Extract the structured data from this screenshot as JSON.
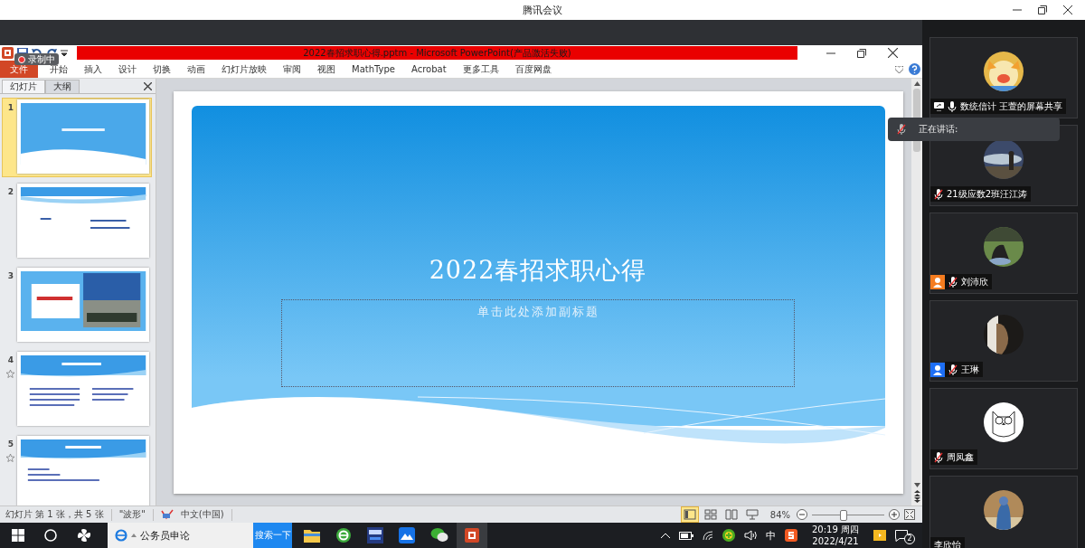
{
  "meeting": {
    "title": "腾讯会议"
  },
  "ppt": {
    "title": "2022春招求职心得.pptm - Microsoft PowerPoint(产品激活失败)",
    "ribbon_tabs": [
      {
        "label": "文件",
        "kind": "file"
      },
      {
        "label": "开始",
        "kind": "tab"
      },
      {
        "label": "插入",
        "kind": "tab"
      },
      {
        "label": "设计",
        "kind": "tab"
      },
      {
        "label": "切换",
        "kind": "tab"
      },
      {
        "label": "动画",
        "kind": "tab"
      },
      {
        "label": "幻灯片放映",
        "kind": "tab"
      },
      {
        "label": "审阅",
        "kind": "tab"
      },
      {
        "label": "视图",
        "kind": "tab"
      },
      {
        "label": "MathType",
        "kind": "tab"
      },
      {
        "label": "Acrobat",
        "kind": "tab"
      },
      {
        "label": "更多工具",
        "kind": "tab"
      },
      {
        "label": "百度网盘",
        "kind": "tab"
      }
    ],
    "panel_tabs": [
      {
        "label": "幻灯片",
        "selected": true
      },
      {
        "label": "大纲",
        "selected": false
      }
    ],
    "slides": [
      {
        "number": "1",
        "selected": true,
        "animated": false,
        "kind": "title"
      },
      {
        "number": "2",
        "selected": false,
        "animated": false,
        "kind": "contents"
      },
      {
        "number": "3",
        "selected": false,
        "animated": false,
        "kind": "photos"
      },
      {
        "number": "4",
        "selected": false,
        "animated": true,
        "kind": "columns"
      },
      {
        "number": "5",
        "selected": false,
        "animated": true,
        "kind": "list"
      }
    ],
    "slide": {
      "title": "2022春招求职心得",
      "subtitle_placeholder": "单击此处添加副标题"
    },
    "status_bar": {
      "position": "幻灯片 第 1 张，共 5 张",
      "theme": "\"波形\"",
      "language": "中文(中国)",
      "zoom": "84%",
      "zoom_slider": {
        "level": 0.42
      }
    },
    "views": [
      {
        "kind": "normal",
        "selected": true
      },
      {
        "kind": "sorter",
        "selected": false
      },
      {
        "kind": "reading",
        "selected": false
      },
      {
        "kind": "show",
        "selected": false
      }
    ]
  },
  "recording": {
    "label": "录制中"
  },
  "participants": [
    {
      "name": "数统信计 王萱的屏幕共享",
      "muted": false,
      "screen_sharing": true
    },
    {
      "name": "21级应数2班汪江涛",
      "muted": true,
      "screen_sharing": false
    },
    {
      "name": "刘沛欣",
      "muted": true,
      "screen_sharing": false,
      "color": "#f57c1f"
    },
    {
      "name": "王琳",
      "muted": true,
      "screen_sharing": false,
      "color": "#1e6ff5"
    },
    {
      "name": "周凤鑫",
      "muted": true,
      "screen_sharing": false
    },
    {
      "name": "李欣怡"
    }
  ],
  "speaking": {
    "label": "正在讲话:"
  },
  "taskbar": {
    "search": {
      "value": "公务员申论"
    },
    "search_button": "搜索一下",
    "input_method": "中",
    "time": "20:19 周四",
    "date": "2022/4/21",
    "notifications": "2"
  }
}
